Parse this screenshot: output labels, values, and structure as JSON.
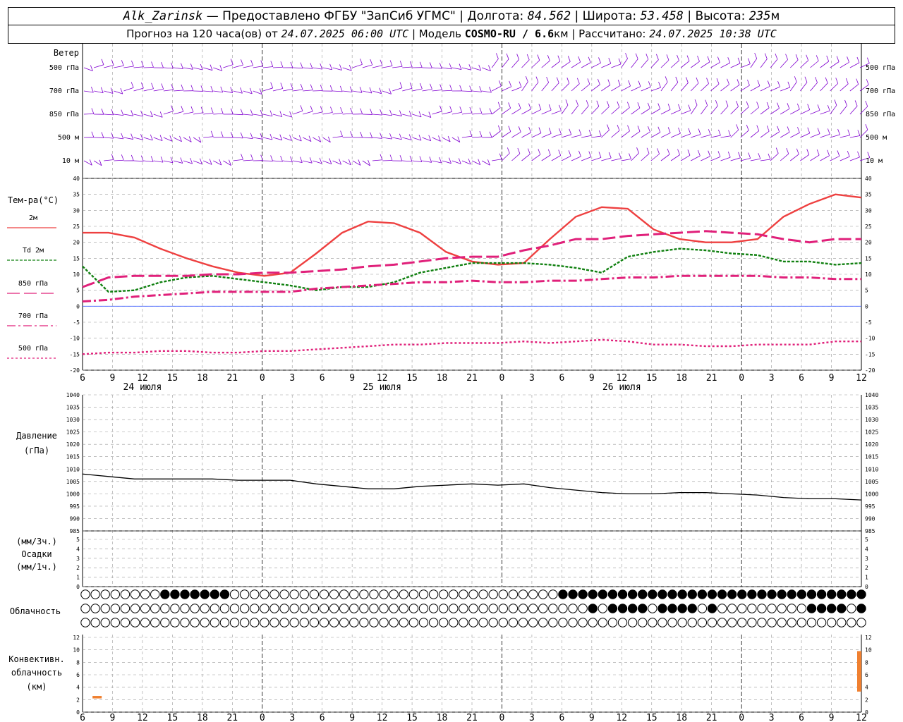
{
  "header": {
    "station": "Alk_Zarinsk",
    "provided": " — Предоставлено ФГБУ \"ЗапСиб УГМС\" | Долгота: ",
    "lon": "84.562",
    "lat_label": " | Широта: ",
    "lat": "53.458",
    "alt_label": " | Высота: ",
    "alt": "235",
    "alt_unit": "м",
    "forecast_prefix": "Прогноз на 120 часа(ов) от ",
    "forecast_time": "24.07.2025 06:00 UTC",
    "model_label": " | Модель ",
    "model": "COSMO-RU / 6.6",
    "model_unit": "км",
    "calc_label": " | Рассчитано: ",
    "calc_time": "24.07.2025 10:38 UTC"
  },
  "wind": {
    "title": "Ветер",
    "levels": [
      "500 гПа",
      "700 гПа",
      "850 гПа",
      "500 м",
      "10 м"
    ],
    "color": "#8000d0"
  },
  "temperature": {
    "title": "Тем-ра(°С)",
    "legend": [
      {
        "label": "2м",
        "color": "#ee4040",
        "dash": ""
      },
      {
        "label": "Td 2м",
        "color": "#108010",
        "dash": "4,2"
      },
      {
        "label": "850 гПа",
        "color": "#e0207a",
        "dash": "18,6"
      },
      {
        "label": "700 гПа",
        "color": "#e0207a",
        "dash": "12,4,3,4"
      },
      {
        "label": "500 гПа",
        "color": "#e0207a",
        "dash": "3,3"
      }
    ]
  },
  "pressure": {
    "title": "Давление",
    "unit": "(гПа)"
  },
  "precip": {
    "unit1": "(мм/3ч.)",
    "title": "Осадки",
    "unit2": "(мм/1ч.)"
  },
  "cloud": {
    "title": "Облачность"
  },
  "conv": {
    "title1": "Конвективн.",
    "title2": "облачность",
    "unit": "(км)",
    "color": "#f08030"
  },
  "days": [
    "24 июля",
    "25 июля",
    "26 июля"
  ],
  "hour_ticks": [
    "6",
    "9",
    "12",
    "15",
    "18",
    "21",
    "0",
    "3",
    "6",
    "9",
    "12",
    "15",
    "18",
    "21",
    "0",
    "3",
    "6",
    "9",
    "12",
    "15",
    "18",
    "21",
    "0",
    "3",
    "6",
    "9",
    "12"
  ],
  "chart_data": [
    {
      "type": "line",
      "name": "temperature",
      "x_hours": [
        0,
        3,
        6,
        9,
        12,
        15,
        18,
        21,
        24,
        27,
        30,
        33,
        36,
        39,
        42,
        45,
        48,
        51,
        54,
        57,
        60,
        63,
        66,
        69,
        72,
        75,
        78
      ],
      "ylim": [
        -20,
        40
      ],
      "yticks": [
        -20,
        -15,
        -10,
        -5,
        0,
        5,
        10,
        15,
        20,
        25,
        30,
        35,
        40
      ],
      "series": [
        {
          "name": "2м",
          "values": [
            23,
            23,
            21.5,
            18,
            15,
            12.5,
            10.5,
            9.5,
            10.5,
            16.5,
            23,
            26.5,
            26,
            23,
            17,
            14,
            13,
            13.5,
            21,
            28,
            31,
            30.5,
            24,
            21,
            20,
            20,
            21,
            28,
            32,
            35,
            34
          ]
        },
        {
          "name": "Td 2м",
          "values": [
            12.5,
            4.5,
            5,
            7.5,
            9,
            9.5,
            8.5,
            7.5,
            6.5,
            5,
            6,
            6,
            7.5,
            10.5,
            12,
            13.5,
            13.5,
            13.5,
            13,
            12,
            10.5,
            15.5,
            17,
            18,
            17.5,
            16.5,
            16,
            14,
            14,
            13,
            13.5
          ]
        },
        {
          "name": "850 гПа",
          "values": [
            6,
            9,
            9.5,
            9.5,
            9.5,
            10,
            10,
            10.5,
            10.5,
            11,
            11.5,
            12.5,
            13,
            14,
            15,
            15.5,
            15.5,
            17.5,
            19,
            21,
            21,
            22,
            22.5,
            23,
            23.5,
            23,
            22.5,
            21,
            20,
            21,
            21
          ]
        },
        {
          "name": "700 гПа",
          "values": [
            1.5,
            2,
            3,
            3.5,
            4,
            4.5,
            4.5,
            4.5,
            4.5,
            5.5,
            6,
            6.5,
            7,
            7.5,
            7.5,
            8,
            7.5,
            7.5,
            8,
            8,
            8.5,
            9,
            9,
            9.5,
            9.5,
            9.5,
            9.5,
            9,
            9,
            8.5,
            8.5
          ]
        },
        {
          "name": "500 гПа",
          "values": [
            -15,
            -14.5,
            -14.5,
            -14,
            -14,
            -14.5,
            -14.5,
            -14,
            -14,
            -13.5,
            -13,
            -12.5,
            -12,
            -12,
            -11.5,
            -11.5,
            -11.5,
            -11,
            -11.5,
            -11,
            -10.5,
            -11,
            -12,
            -12,
            -12.5,
            -12.5,
            -12,
            -12,
            -12,
            -11,
            -11
          ]
        }
      ]
    },
    {
      "type": "line",
      "name": "pressure",
      "ylim": [
        985,
        1040
      ],
      "yticks": [
        985,
        990,
        995,
        1000,
        1005,
        1010,
        1015,
        1020,
        1025,
        1030,
        1035,
        1040
      ],
      "series": [
        {
          "name": "",
          "values": [
            1008,
            1007,
            1006,
            1006,
            1006,
            1006,
            1005.5,
            1005.5,
            1005.5,
            1004,
            1003,
            1002,
            1002,
            1003,
            1003.5,
            1004,
            1003.5,
            1004,
            1002.5,
            1001.5,
            1000.5,
            1000,
            1000,
            1000.5,
            1000.5,
            1000,
            999.5,
            998.5,
            998,
            998,
            997.5
          ]
        }
      ]
    },
    {
      "type": "bar",
      "name": "precipitation",
      "ylim": [
        0,
        5
      ],
      "yticks": [
        0,
        1,
        2,
        3,
        4,
        5
      ],
      "values": []
    },
    {
      "type": "bar",
      "name": "convective_cloud",
      "ylim": [
        0,
        12
      ],
      "yticks": [
        0,
        2,
        4,
        6,
        8,
        10,
        12
      ],
      "bars": [
        {
          "x_hour": 1,
          "base_km": 2.2,
          "top_km": 2.6
        },
        {
          "x_hour": 78,
          "base_km": 3.3,
          "top_km": 9.8
        }
      ]
    }
  ]
}
